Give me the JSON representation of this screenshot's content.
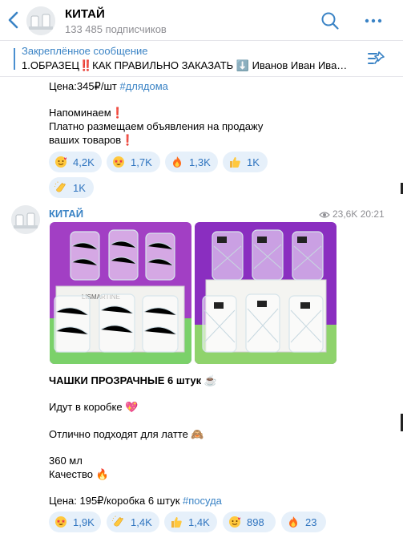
{
  "header": {
    "title": "КИТАЙ",
    "subscribers": "133 485 подписчиков"
  },
  "pinned": {
    "title": "Закреплённое сообщение",
    "text": "1.ОБРАЗЕЦ‼️КАК ПРАВИЛЬНО ЗАКАЗАТЬ ⬇️    Иванов Иван Ива…"
  },
  "post1": {
    "price_text": "Цена:345₽/шт",
    "tag": "#длядома",
    "line1": "Напоминаем❗️",
    "line2": "Платно размещаем объявления на продажу",
    "line3": "ваших товаров❗️",
    "reactions": [
      {
        "emoji": "heart-face",
        "count": "4,2K"
      },
      {
        "emoji": "star-struck",
        "count": "1,7K"
      },
      {
        "emoji": "fire",
        "count": "1,3K"
      },
      {
        "emoji": "thumbs-up",
        "count": "1K"
      },
      {
        "emoji": "clap",
        "count": "1K"
      }
    ]
  },
  "post2": {
    "author": "КИТАЙ",
    "views": "23,6K",
    "time": "20:21",
    "title": "ЧАШКИ ПРОЗРАЧНЫЕ 6 штук ☕️",
    "line1": "Идут в коробке 💖",
    "line2": "Отлично подходят для латте 🙈",
    "line3": "360 мл",
    "line4": "Качество 🔥",
    "price_text": "Цена: 195₽/коробка 6 штук",
    "tag": "#посуда",
    "photo_box_label": "LISMARTINE",
    "reactions": [
      {
        "emoji": "star-struck",
        "count": "1,9K"
      },
      {
        "emoji": "clap",
        "count": "1,4K"
      },
      {
        "emoji": "thumbs-up",
        "count": "1,4K"
      },
      {
        "emoji": "heart-face",
        "count": "898"
      },
      {
        "emoji": "fire",
        "count": "23"
      }
    ]
  },
  "colors": {
    "accent": "#3a83c5",
    "pill_bg": "#e6f0fa",
    "photo_bg_left": "#a23fc4",
    "photo_bg_right": "#8a2ec0"
  }
}
